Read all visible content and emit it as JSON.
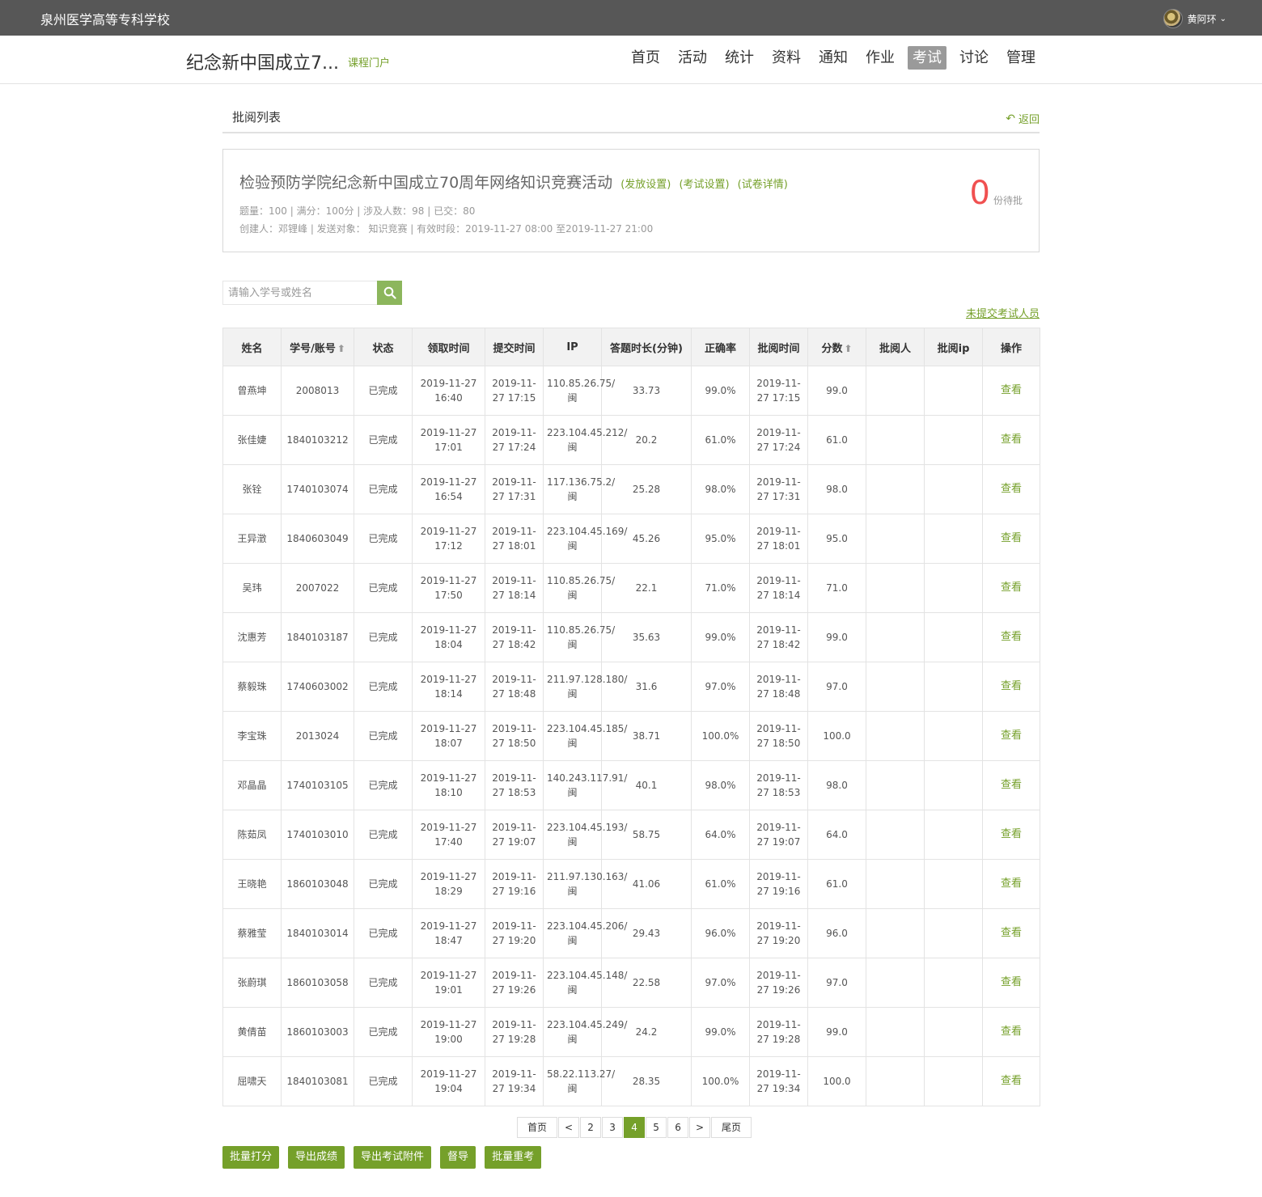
{
  "header": {
    "school": "泉州医学高等专科学校",
    "user_name": "黄阿环"
  },
  "course": {
    "title": "纪念新中国成立7...",
    "portal_link": "课程门户",
    "nav": [
      "首页",
      "活动",
      "统计",
      "资料",
      "通知",
      "作业",
      "考试",
      "讨论",
      "管理"
    ],
    "active_nav": "考试"
  },
  "section": {
    "title": "批阅列表",
    "back_label": "返回"
  },
  "exam": {
    "title": "检验预防学院纪念新中国成立70周年网络知识竞赛活动",
    "links": [
      "(发放设置)",
      "(考试设置)",
      "(试卷详情)"
    ],
    "meta_line1": "题量：100 |  满分：100分 |  涉及人数：98 | 已交：80",
    "meta_line2": "创建人：邓锂峰 | 发送对象：  知识竞赛  |  有效时段：2019-11-27 08:00 至2019-11-27 21:00",
    "pending_count": "0",
    "pending_label": "份待批"
  },
  "search": {
    "placeholder": "请输入学号或姓名"
  },
  "unsubmitted_link": "未提交考试人员",
  "table": {
    "columns": [
      "姓名",
      "学号/账号",
      "状态",
      "领取时间",
      "提交时间",
      "IP",
      "答题时长(分钟)",
      "正确率",
      "批阅时间",
      "分数",
      "批阅人",
      "批阅ip",
      "操作"
    ],
    "rows": [
      {
        "name": "曾燕坤",
        "id": "2008013",
        "status": "已完成",
        "get_time": "2019-11-27 16:40",
        "submit_time": "2019-11-27 17:15",
        "ip": "110.85.26.75/闽",
        "duration": "33.73",
        "accuracy": "99.0%",
        "review_time": "2019-11-27 17:15",
        "score": "99.0",
        "reviewer": "",
        "reviewer_ip": "",
        "action": "查看"
      },
      {
        "name": "张佳婕",
        "id": "1840103212",
        "status": "已完成",
        "get_time": "2019-11-27 17:01",
        "submit_time": "2019-11-27 17:24",
        "ip": "223.104.45.212/闽",
        "duration": "20.2",
        "accuracy": "61.0%",
        "review_time": "2019-11-27 17:24",
        "score": "61.0",
        "reviewer": "",
        "reviewer_ip": "",
        "action": "查看"
      },
      {
        "name": "张铨",
        "id": "1740103074",
        "status": "已完成",
        "get_time": "2019-11-27 16:54",
        "submit_time": "2019-11-27 17:31",
        "ip": "117.136.75.2/闽",
        "duration": "25.28",
        "accuracy": "98.0%",
        "review_time": "2019-11-27 17:31",
        "score": "98.0",
        "reviewer": "",
        "reviewer_ip": "",
        "action": "查看"
      },
      {
        "name": "王异澂",
        "id": "1840603049",
        "status": "已完成",
        "get_time": "2019-11-27 17:12",
        "submit_time": "2019-11-27 18:01",
        "ip": "223.104.45.169/闽",
        "duration": "45.26",
        "accuracy": "95.0%",
        "review_time": "2019-11-27 18:01",
        "score": "95.0",
        "reviewer": "",
        "reviewer_ip": "",
        "action": "查看"
      },
      {
        "name": "吴玮",
        "id": "2007022",
        "status": "已完成",
        "get_time": "2019-11-27 17:50",
        "submit_time": "2019-11-27 18:14",
        "ip": "110.85.26.75/闽",
        "duration": "22.1",
        "accuracy": "71.0%",
        "review_time": "2019-11-27 18:14",
        "score": "71.0",
        "reviewer": "",
        "reviewer_ip": "",
        "action": "查看"
      },
      {
        "name": "沈惠芳",
        "id": "1840103187",
        "status": "已完成",
        "get_time": "2019-11-27 18:04",
        "submit_time": "2019-11-27 18:42",
        "ip": "110.85.26.75/闽",
        "duration": "35.63",
        "accuracy": "99.0%",
        "review_time": "2019-11-27 18:42",
        "score": "99.0",
        "reviewer": "",
        "reviewer_ip": "",
        "action": "查看"
      },
      {
        "name": "蔡毅珠",
        "id": "1740603002",
        "status": "已完成",
        "get_time": "2019-11-27 18:14",
        "submit_time": "2019-11-27 18:48",
        "ip": "211.97.128.180/闽",
        "duration": "31.6",
        "accuracy": "97.0%",
        "review_time": "2019-11-27 18:48",
        "score": "97.0",
        "reviewer": "",
        "reviewer_ip": "",
        "action": "查看"
      },
      {
        "name": "李宝珠",
        "id": "2013024",
        "status": "已完成",
        "get_time": "2019-11-27 18:07",
        "submit_time": "2019-11-27 18:50",
        "ip": "223.104.45.185/闽",
        "duration": "38.71",
        "accuracy": "100.0%",
        "review_time": "2019-11-27 18:50",
        "score": "100.0",
        "reviewer": "",
        "reviewer_ip": "",
        "action": "查看"
      },
      {
        "name": "邓晶晶",
        "id": "1740103105",
        "status": "已完成",
        "get_time": "2019-11-27 18:10",
        "submit_time": "2019-11-27 18:53",
        "ip": "140.243.117.91/闽",
        "duration": "40.1",
        "accuracy": "98.0%",
        "review_time": "2019-11-27 18:53",
        "score": "98.0",
        "reviewer": "",
        "reviewer_ip": "",
        "action": "查看"
      },
      {
        "name": "陈茹凤",
        "id": "1740103010",
        "status": "已完成",
        "get_time": "2019-11-27 17:40",
        "submit_time": "2019-11-27 19:07",
        "ip": "223.104.45.193/闽",
        "duration": "58.75",
        "accuracy": "64.0%",
        "review_time": "2019-11-27 19:07",
        "score": "64.0",
        "reviewer": "",
        "reviewer_ip": "",
        "action": "查看"
      },
      {
        "name": "王晓艳",
        "id": "1860103048",
        "status": "已完成",
        "get_time": "2019-11-27 18:29",
        "submit_time": "2019-11-27 19:16",
        "ip": "211.97.130.163/闽",
        "duration": "41.06",
        "accuracy": "61.0%",
        "review_time": "2019-11-27 19:16",
        "score": "61.0",
        "reviewer": "",
        "reviewer_ip": "",
        "action": "查看"
      },
      {
        "name": "蔡雅莹",
        "id": "1840103014",
        "status": "已完成",
        "get_time": "2019-11-27 18:47",
        "submit_time": "2019-11-27 19:20",
        "ip": "223.104.45.206/闽",
        "duration": "29.43",
        "accuracy": "96.0%",
        "review_time": "2019-11-27 19:20",
        "score": "96.0",
        "reviewer": "",
        "reviewer_ip": "",
        "action": "查看"
      },
      {
        "name": "张蔚琪",
        "id": "1860103058",
        "status": "已完成",
        "get_time": "2019-11-27 19:01",
        "submit_time": "2019-11-27 19:26",
        "ip": "223.104.45.148/闽",
        "duration": "22.58",
        "accuracy": "97.0%",
        "review_time": "2019-11-27 19:26",
        "score": "97.0",
        "reviewer": "",
        "reviewer_ip": "",
        "action": "查看"
      },
      {
        "name": "黄倩苗",
        "id": "1860103003",
        "status": "已完成",
        "get_time": "2019-11-27 19:00",
        "submit_time": "2019-11-27 19:28",
        "ip": "223.104.45.249/闽",
        "duration": "24.2",
        "accuracy": "99.0%",
        "review_time": "2019-11-27 19:28",
        "score": "99.0",
        "reviewer": "",
        "reviewer_ip": "",
        "action": "查看"
      },
      {
        "name": "屈啸天",
        "id": "1840103081",
        "status": "已完成",
        "get_time": "2019-11-27 19:04",
        "submit_time": "2019-11-27 19:34",
        "ip": "58.22.113.27/闽",
        "duration": "28.35",
        "accuracy": "100.0%",
        "review_time": "2019-11-27 19:34",
        "score": "100.0",
        "reviewer": "",
        "reviewer_ip": "",
        "action": "查看"
      }
    ]
  },
  "pagination": {
    "items": [
      "首页",
      "<",
      "2",
      "3",
      "4",
      "5",
      "6",
      ">",
      "尾页"
    ],
    "current": "4"
  },
  "actions": [
    "批量打分",
    "导出成绩",
    "导出考试附件",
    "督导",
    "批量重考"
  ],
  "colors": {
    "accent": "#75a02a",
    "topbar": "#575757",
    "pending": "#f05050"
  },
  "icons": {
    "search": "search-icon",
    "back": "back-arrow-icon",
    "sort": "sort-up-icon",
    "dropdown": "chevron-down-icon"
  }
}
